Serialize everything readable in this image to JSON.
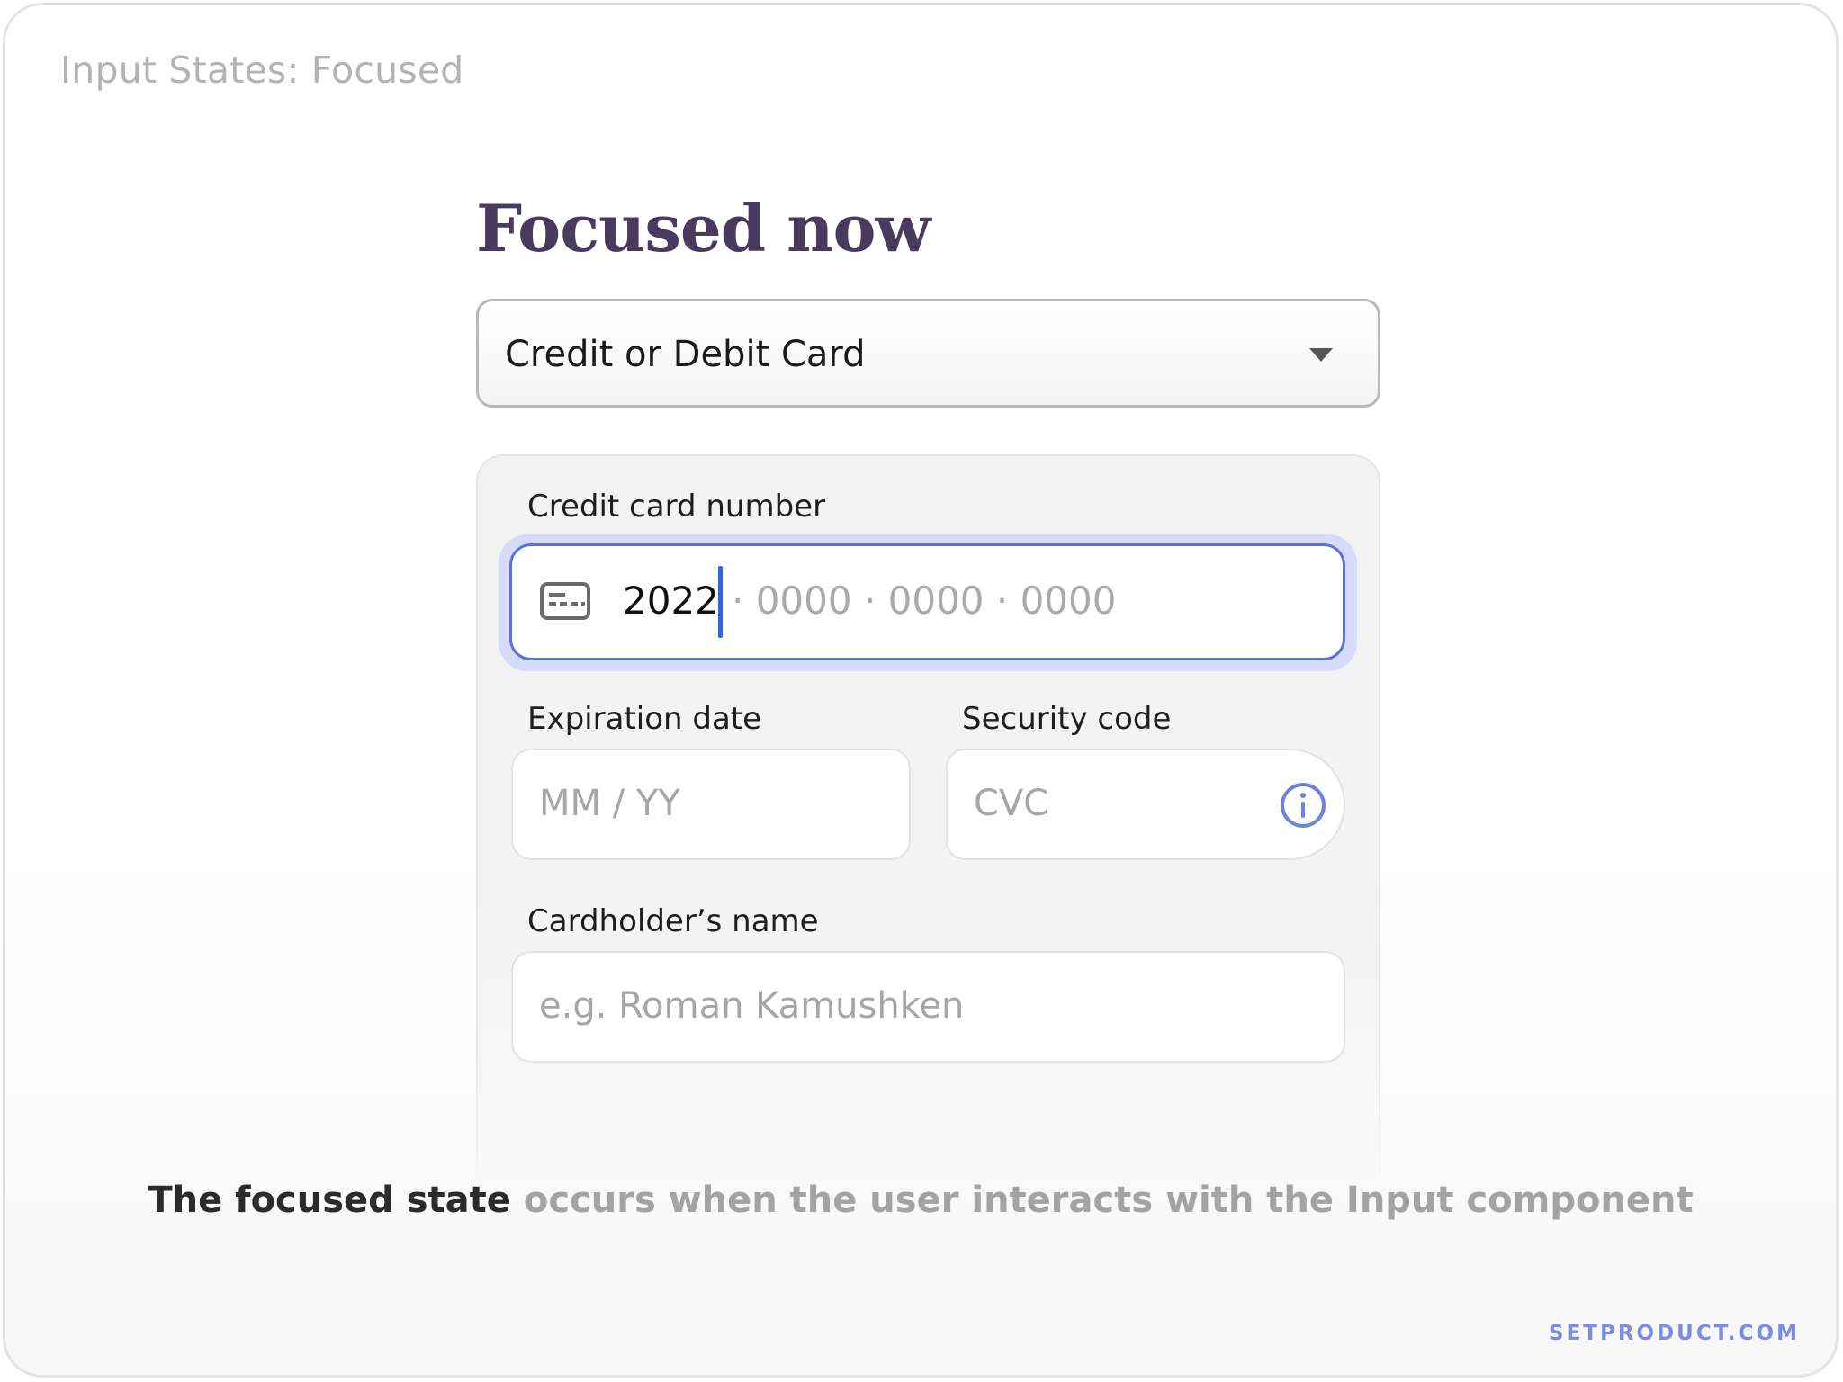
{
  "page": {
    "caption": "Input States: Focused",
    "heading": "Focused now",
    "brand": "SETPRODUCT.COM",
    "bottom_caption": {
      "strong": "The focused state",
      "rest": " occurs when the user interacts with the Input component"
    }
  },
  "payment_select": {
    "value": "Credit or Debit Card"
  },
  "form": {
    "card_number": {
      "label": "Credit card number",
      "typed": "2022",
      "remaining_placeholder": "· 0000 · 0000 · 0000"
    },
    "expiration": {
      "label": "Expiration date",
      "placeholder": "MM / YY"
    },
    "security": {
      "label": "Security code",
      "placeholder": "CVC"
    },
    "cardholder": {
      "label": "Cardholder’s name",
      "placeholder": "e.g. Roman Kamushken"
    }
  },
  "colors": {
    "heading": "#4a3a5e",
    "focus_border": "#5a72dc",
    "focus_ring": "#d6dcf8",
    "cursor": "#2f64e8",
    "accent": "#6e82dc"
  },
  "icons": {
    "select_caret": "chevron-down-icon",
    "card_icon": "credit-card-icon",
    "info_icon": "info-icon"
  }
}
